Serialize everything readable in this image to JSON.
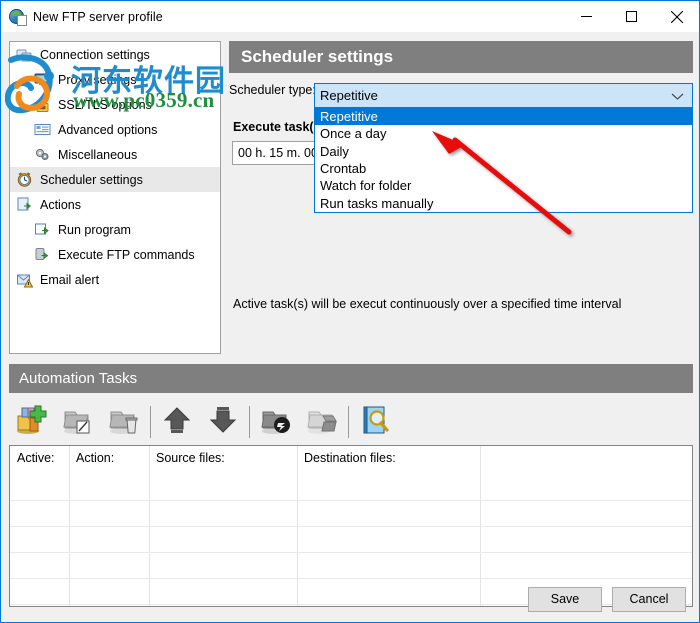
{
  "window": {
    "title": "New FTP server profile",
    "app_icon": "ftp-globe-icon",
    "controls": {
      "minimize": "minimize-icon",
      "maximize": "maximize-icon",
      "close": "close-icon"
    }
  },
  "sidebar": {
    "items": [
      {
        "label": "Connection settings",
        "icon": "connection-icon",
        "indent": false,
        "selected": false
      },
      {
        "label": "Proxy settings",
        "icon": "proxy-icon",
        "indent": true,
        "selected": false
      },
      {
        "label": "SSL/TLS options",
        "icon": "lock-icon",
        "indent": true,
        "selected": false
      },
      {
        "label": "Advanced options",
        "icon": "list-icon",
        "indent": true,
        "selected": false
      },
      {
        "label": "Miscellaneous",
        "icon": "gears-icon",
        "indent": true,
        "selected": false
      },
      {
        "label": "Scheduler settings",
        "icon": "clock-icon",
        "indent": false,
        "selected": true
      },
      {
        "label": "Actions",
        "icon": "actions-icon",
        "indent": false,
        "selected": false
      },
      {
        "label": "Run program",
        "icon": "run-program-icon",
        "indent": true,
        "selected": false
      },
      {
        "label": "Execute FTP commands",
        "icon": "ftp-command-icon",
        "indent": true,
        "selected": false
      },
      {
        "label": "Email alert",
        "icon": "email-alert-icon",
        "indent": false,
        "selected": false
      }
    ]
  },
  "scheduler": {
    "section_title": "Scheduler settings",
    "type_label": "Scheduler type:",
    "selected_type": "Repetitive",
    "options": [
      "Repetitive",
      "Once a day",
      "Daily",
      "Crontab",
      "Watch for folder",
      "Run tasks manually"
    ],
    "highlighted_option": "Repetitive",
    "execute_label": "Execute task(s) every:",
    "interval_value": "00 h. 15 m. 00 s.",
    "description": "Active task(s) will be execut continuously over a specified time interval",
    "dropdown_arrow_icon": "chevron-down-icon"
  },
  "tasks": {
    "header": "Automation Tasks",
    "toolbar": [
      {
        "name": "add-task-button",
        "icon": "add-task-icon",
        "enabled": true
      },
      {
        "name": "edit-task-button",
        "icon": "edit-task-icon",
        "enabled": false
      },
      {
        "name": "delete-task-button",
        "icon": "delete-task-icon",
        "enabled": false
      },
      {
        "name": "move-up-button",
        "icon": "arrow-up-icon",
        "enabled": true
      },
      {
        "name": "move-down-button",
        "icon": "arrow-down-icon",
        "enabled": true
      },
      {
        "name": "disable-task-button",
        "icon": "task-disable-icon",
        "enabled": true
      },
      {
        "name": "enable-task-button",
        "icon": "task-enable-icon",
        "enabled": false
      },
      {
        "name": "preview-task-button",
        "icon": "search-icon",
        "enabled": true
      }
    ],
    "columns": [
      "Active:",
      "Action:",
      "Source files:",
      "Destination files:",
      ""
    ],
    "rows": []
  },
  "footer": {
    "save_label": "Save",
    "cancel_label": "Cancel"
  },
  "annotation": {
    "arrow": "red-arrow-pointing-to-repetitive-option",
    "arrow_color": "#e8090b"
  },
  "watermark": {
    "site_name": "河东软件园",
    "url": "www.pc0359.cn"
  },
  "colors": {
    "accent": "#0078d7",
    "section_header_bg": "#7f7f7f",
    "combo_bg": "#cce4f7",
    "window_bg": "#f0f0f0"
  }
}
